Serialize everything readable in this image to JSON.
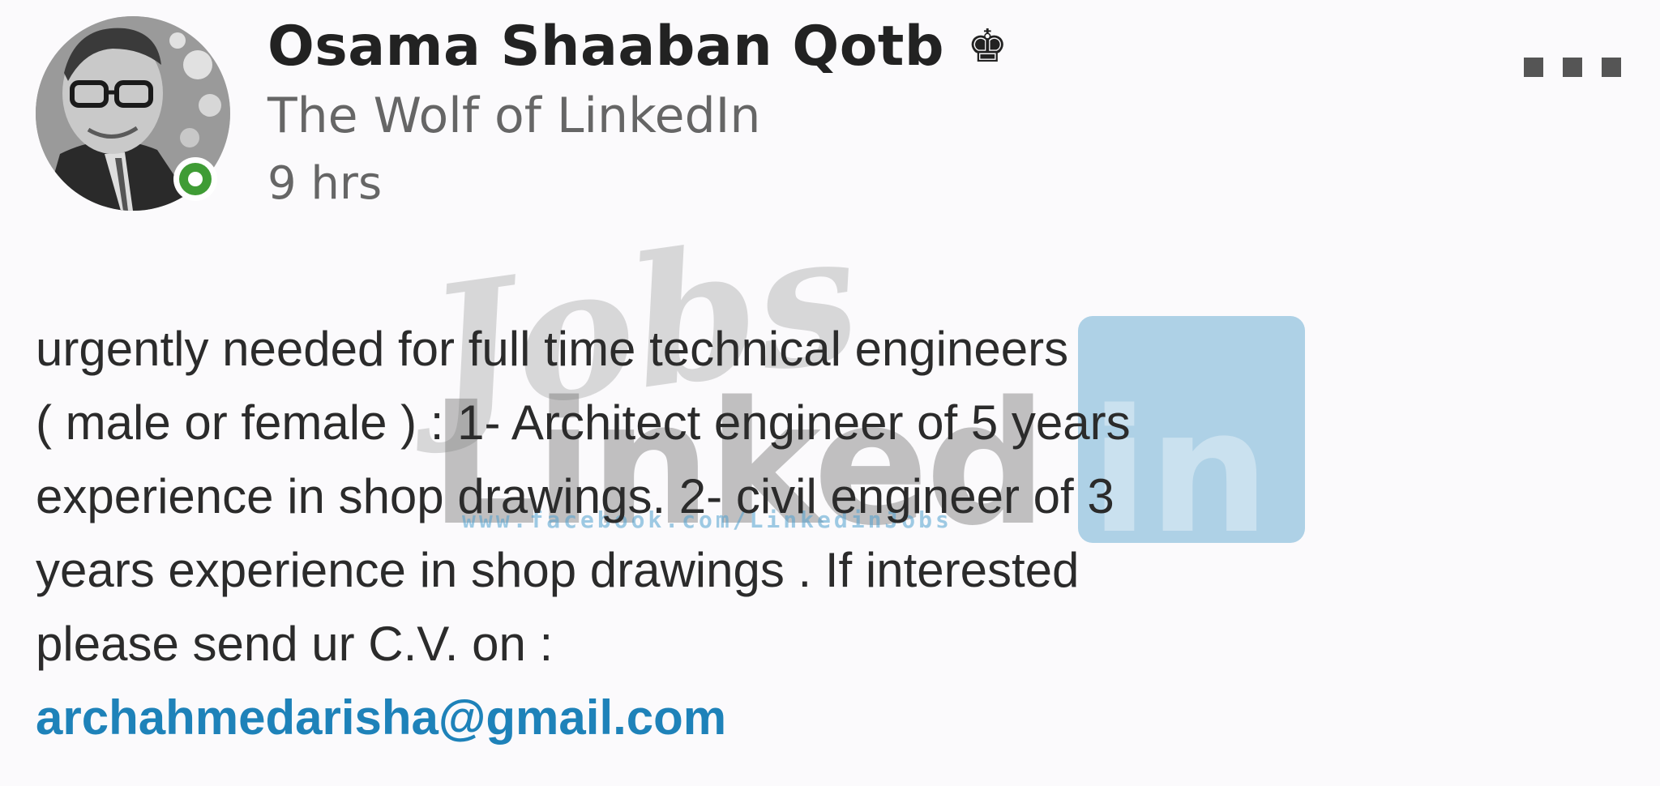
{
  "post": {
    "author": {
      "name": "Osama Shaaban Qotb",
      "badge_icon": "crown-icon",
      "headline": "The Wolf of LinkedIn",
      "online_status": "online",
      "status_color": "#3f9c35"
    },
    "time": "9 hrs",
    "menu_icon": "more-options-icon",
    "body_lines": [
      "urgently needed for full time technical engineers",
      "( male or female ) : 1- Architect engineer of 5 years",
      "experience in shop drawings. 2- civil engineer of 3",
      "years experience in shop drawings . If interested",
      "please send ur C.V. on :"
    ],
    "email": "archahmedarisha@gmail.com",
    "link_color": "#1e82b9"
  },
  "watermark": {
    "jobs": "Jobs",
    "linked": "Linked",
    "in": "in",
    "url": "www.facebook.com/LinkedinJobs"
  }
}
